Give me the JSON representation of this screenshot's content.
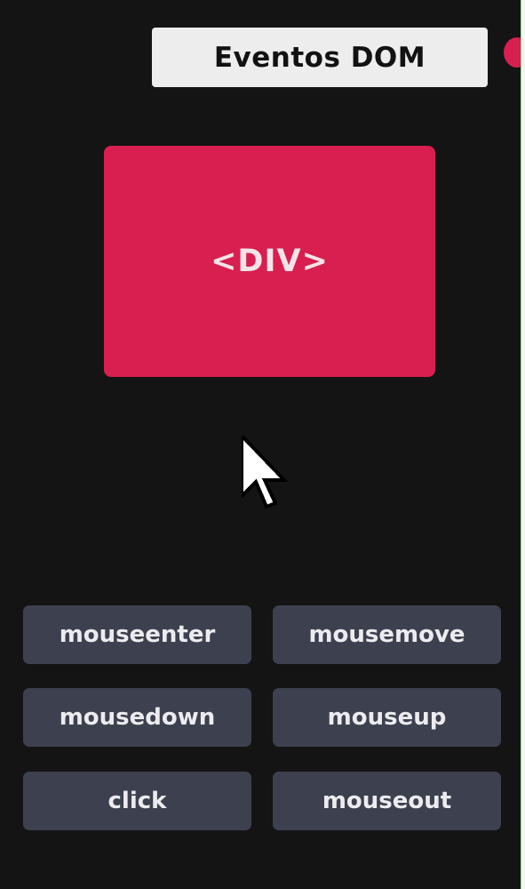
{
  "header": {
    "title": "Eventos DOM"
  },
  "target": {
    "label": "<DIV>"
  },
  "events": [
    {
      "label": "mouseenter"
    },
    {
      "label": "mousemove"
    },
    {
      "label": "mousedown"
    },
    {
      "label": "mouseup"
    },
    {
      "label": "click"
    },
    {
      "label": "mouseout"
    }
  ],
  "colors": {
    "accent": "#d81f4f",
    "background": "#141414",
    "button": "#3d414f",
    "title_bg": "#ededed"
  },
  "icons": {
    "cursor": "arrow-cursor-icon",
    "indicator": "record-dot-icon"
  }
}
